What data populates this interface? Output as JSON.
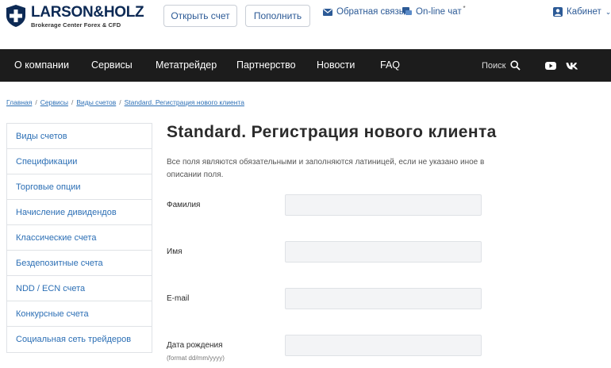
{
  "header": {
    "logo_title": "LARSON&HOLZ",
    "logo_subtitle": "Brokerage Center Forex & CFD",
    "open_account_label": "Открыть счет",
    "fund_label": "Пополнить",
    "feedback_label": "Обратная связь",
    "chat_label": "On-line чат",
    "chat_marker": "*",
    "cabinet_label": "Кабинет"
  },
  "nav": {
    "items": [
      "О компании",
      "Сервисы",
      "Метатрейдер",
      "Партнерство",
      "Новости",
      "FAQ"
    ],
    "search_label": "Поиск"
  },
  "breadcrumb": [
    "Главная",
    "Сервисы",
    "Виды счетов",
    "Standard. Регистрация нового клиента"
  ],
  "sidebar": {
    "items": [
      "Виды счетов",
      "Спецификации",
      "Торговые опции",
      "Начисление дивидендов",
      "Классические счета",
      "Бездепозитные счета",
      "NDD / ECN счета",
      "Конкурсные счета",
      "Социальная сеть трейдеров"
    ]
  },
  "main": {
    "title": "Standard. Регистрация нового клиента",
    "description": "Все поля являются обязательными и заполняются латиницей, если не указано иное в описании поля.",
    "fields": [
      {
        "label": "Фамилия",
        "value": ""
      },
      {
        "label": "Имя",
        "value": ""
      },
      {
        "label": "E-mail",
        "value": ""
      },
      {
        "label": "Дата рождения",
        "hint": "(format dd/mm/yyyy)",
        "value": ""
      }
    ]
  },
  "colors": {
    "brand_navy": "#0d2a55",
    "link_blue": "#2c6fb5",
    "navbar_bg": "#1c1c1c",
    "input_bg": "#f3f4f6"
  }
}
